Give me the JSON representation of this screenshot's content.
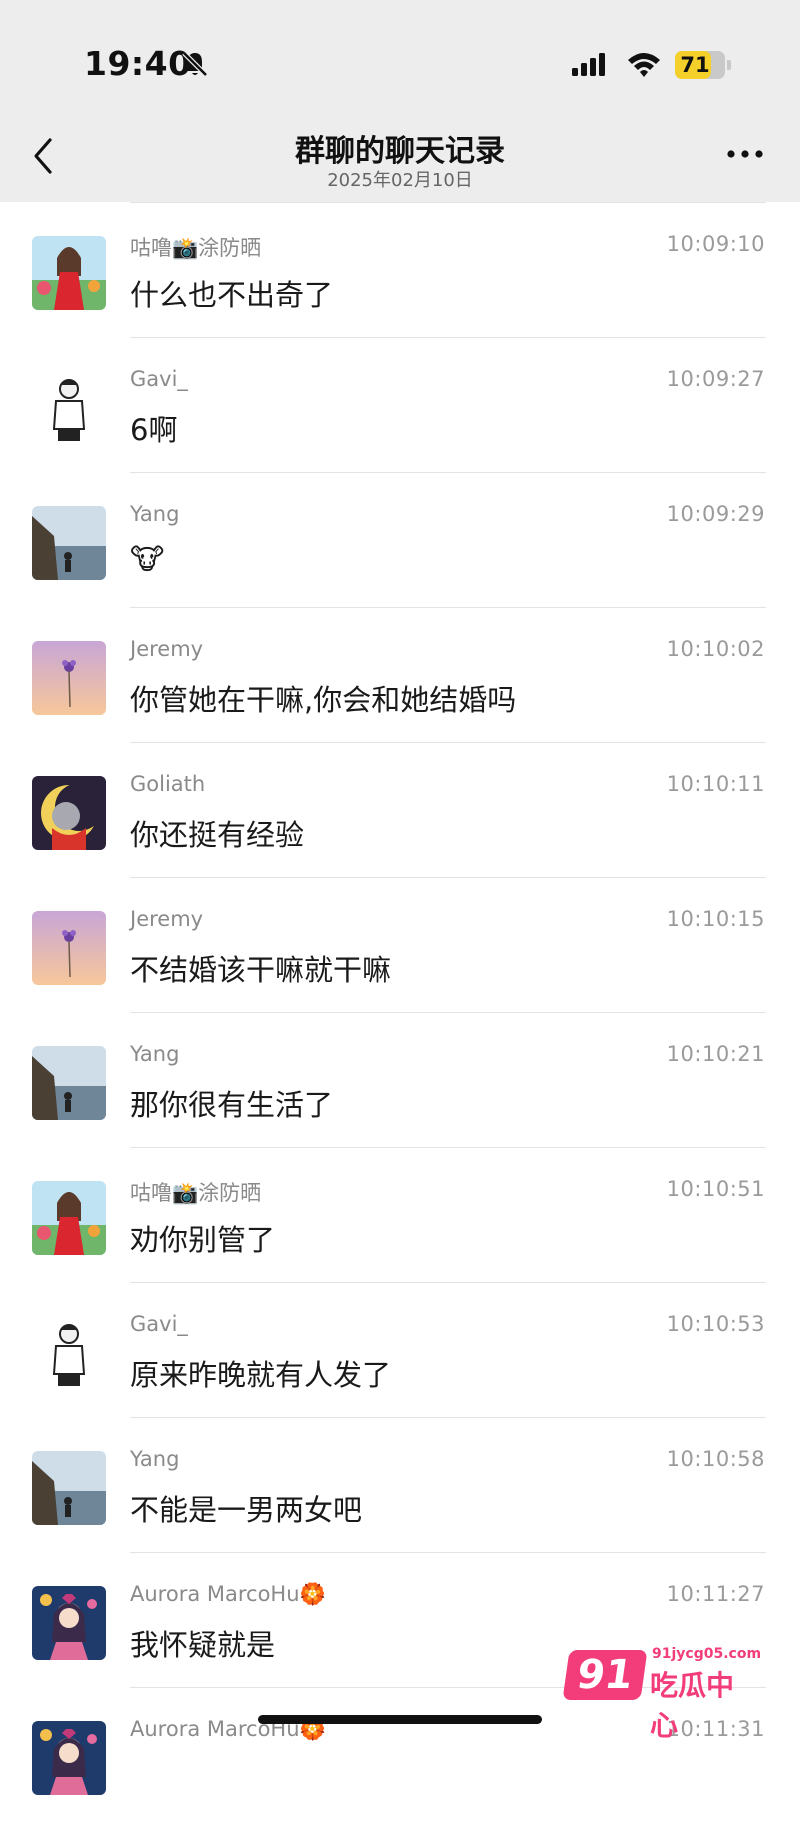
{
  "status_bar": {
    "time": "19:40",
    "battery": "71",
    "battery_level": 0.71
  },
  "nav": {
    "title": "群聊的聊天记录",
    "subtitle": "2025年02月10日"
  },
  "messages": [
    {
      "sender": "咕噜📸涂防晒",
      "time": "10:09:10",
      "text": "什么也不出奇了",
      "avatar": "girl-garden"
    },
    {
      "sender": "Gavi_",
      "time": "10:09:27",
      "text": "6啊",
      "avatar": "sketch-man"
    },
    {
      "sender": "Yang",
      "time": "10:09:29",
      "text": "🐮",
      "avatar": "seaside"
    },
    {
      "sender": "Jeremy",
      "time": "10:10:02",
      "text": "你管她在干嘛,你会和她结婚吗",
      "avatar": "flower-sunset"
    },
    {
      "sender": "Goliath",
      "time": "10:10:11",
      "text": "你还挺有经验",
      "avatar": "cartoon-moon"
    },
    {
      "sender": "Jeremy",
      "time": "10:10:15",
      "text": "不结婚该干嘛就干嘛",
      "avatar": "flower-sunset"
    },
    {
      "sender": "Yang",
      "time": "10:10:21",
      "text": "那你很有生活了",
      "avatar": "seaside"
    },
    {
      "sender": "咕噜📸涂防晒",
      "time": "10:10:51",
      "text": "劝你别管了",
      "avatar": "girl-garden"
    },
    {
      "sender": "Gavi_",
      "time": "10:10:53",
      "text": "原来昨晚就有人发了",
      "avatar": "sketch-man"
    },
    {
      "sender": "Yang",
      "time": "10:10:58",
      "text": "不能是一男两女吧",
      "avatar": "seaside"
    },
    {
      "sender": "Aurora MarcoHu🏵️",
      "time": "10:11:27",
      "text": "我怀疑就是",
      "avatar": "anime-girl"
    },
    {
      "sender": "Aurora MarcoHu🏵️",
      "time": "10:11:31",
      "text": "",
      "avatar": "anime-girl"
    }
  ],
  "watermark": {
    "badge": "91",
    "url": "91jycg05.com",
    "text": "吃瓜中心"
  },
  "colors": {
    "header_bg": "#ededed",
    "battery": "#f5cf2a",
    "watermark": "#f23d7a"
  }
}
